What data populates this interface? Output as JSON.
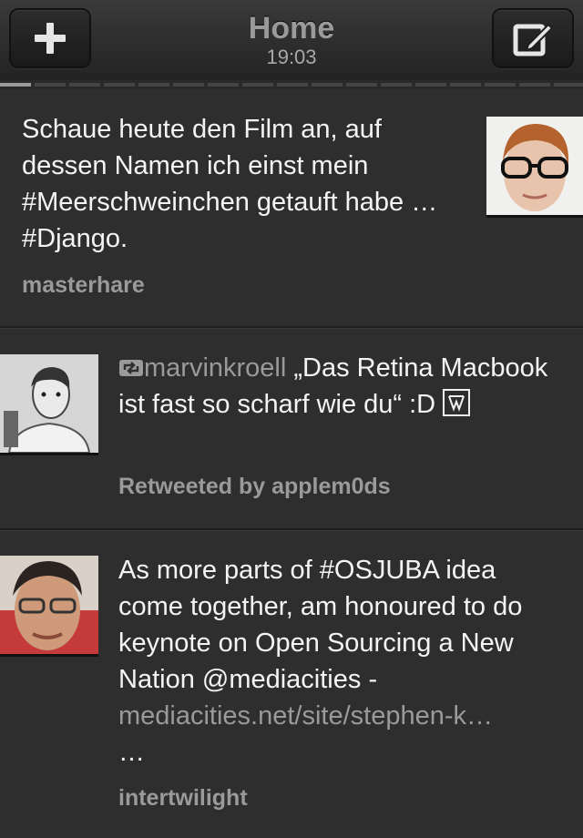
{
  "header": {
    "title": "Home",
    "time": "19:03",
    "left_button": "plus-icon",
    "right_button": "compose-icon"
  },
  "pager": {
    "pages": 17,
    "active": 0
  },
  "tweets": [
    {
      "text": "Schaue heute den Film an, auf dessen Namen ich einst mein #Meerschweinchen getauft habe … #Django.",
      "author": "masterhare"
    },
    {
      "retweet_user": "marvinkroell",
      "text": "„Das Retina Macbook ist fast so scharf wie du“ :D",
      "meta": "Retweeted by applem0ds"
    },
    {
      "text": "As more parts of #OSJUBA idea come together, am honoured to do keynote on Open Sourcing a New Nation @mediacities -",
      "link": "mediacities.net/site/stephen-k…",
      "ellipsis": "…",
      "author": "intertwilight"
    }
  ],
  "colors": {
    "background": "#2e2e2e",
    "text": "#f4f4f4",
    "meta": "#9a9a9a"
  }
}
